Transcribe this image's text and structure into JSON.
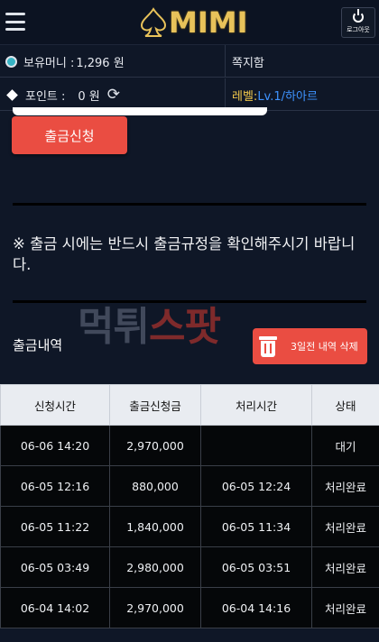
{
  "header": {
    "logo_text": "MIMI",
    "logout_label": "로그아웃"
  },
  "info": {
    "money_label": "보유머니 :",
    "money_value": "1,296 원",
    "messages_label": "쪽지함",
    "points_label": "포인트 :",
    "points_value": "0 원",
    "level_label": "레벨:",
    "level_value": "Lv.1/하아르"
  },
  "actions": {
    "withdraw_button": "출금신청",
    "delete_button": "3일전 내역 삭제"
  },
  "notice": "※ 출금 시에는 반드시 출금규정을 확인해주시기 바랍니다.",
  "watermark": {
    "part1": "먹튀",
    "part2": "스팟"
  },
  "history": {
    "title": "출금내역",
    "columns": [
      "신청시간",
      "출금신청금",
      "처리시간",
      "상태"
    ],
    "rows": [
      [
        "06-06 14:20",
        "2,970,000",
        "",
        "대기"
      ],
      [
        "06-05 12:16",
        "880,000",
        "06-05 12:24",
        "처리완료"
      ],
      [
        "06-05 11:22",
        "1,840,000",
        "06-05 11:34",
        "처리완료"
      ],
      [
        "06-05 03:49",
        "2,980,000",
        "06-05 03:51",
        "처리완료"
      ],
      [
        "06-04 14:02",
        "2,970,000",
        "06-04 14:16",
        "처리완료"
      ]
    ]
  },
  "colors": {
    "accent": "#ea4d42",
    "background": "#0f1727",
    "gold": "#e8c25a",
    "level_blue": "#3e93ff"
  }
}
